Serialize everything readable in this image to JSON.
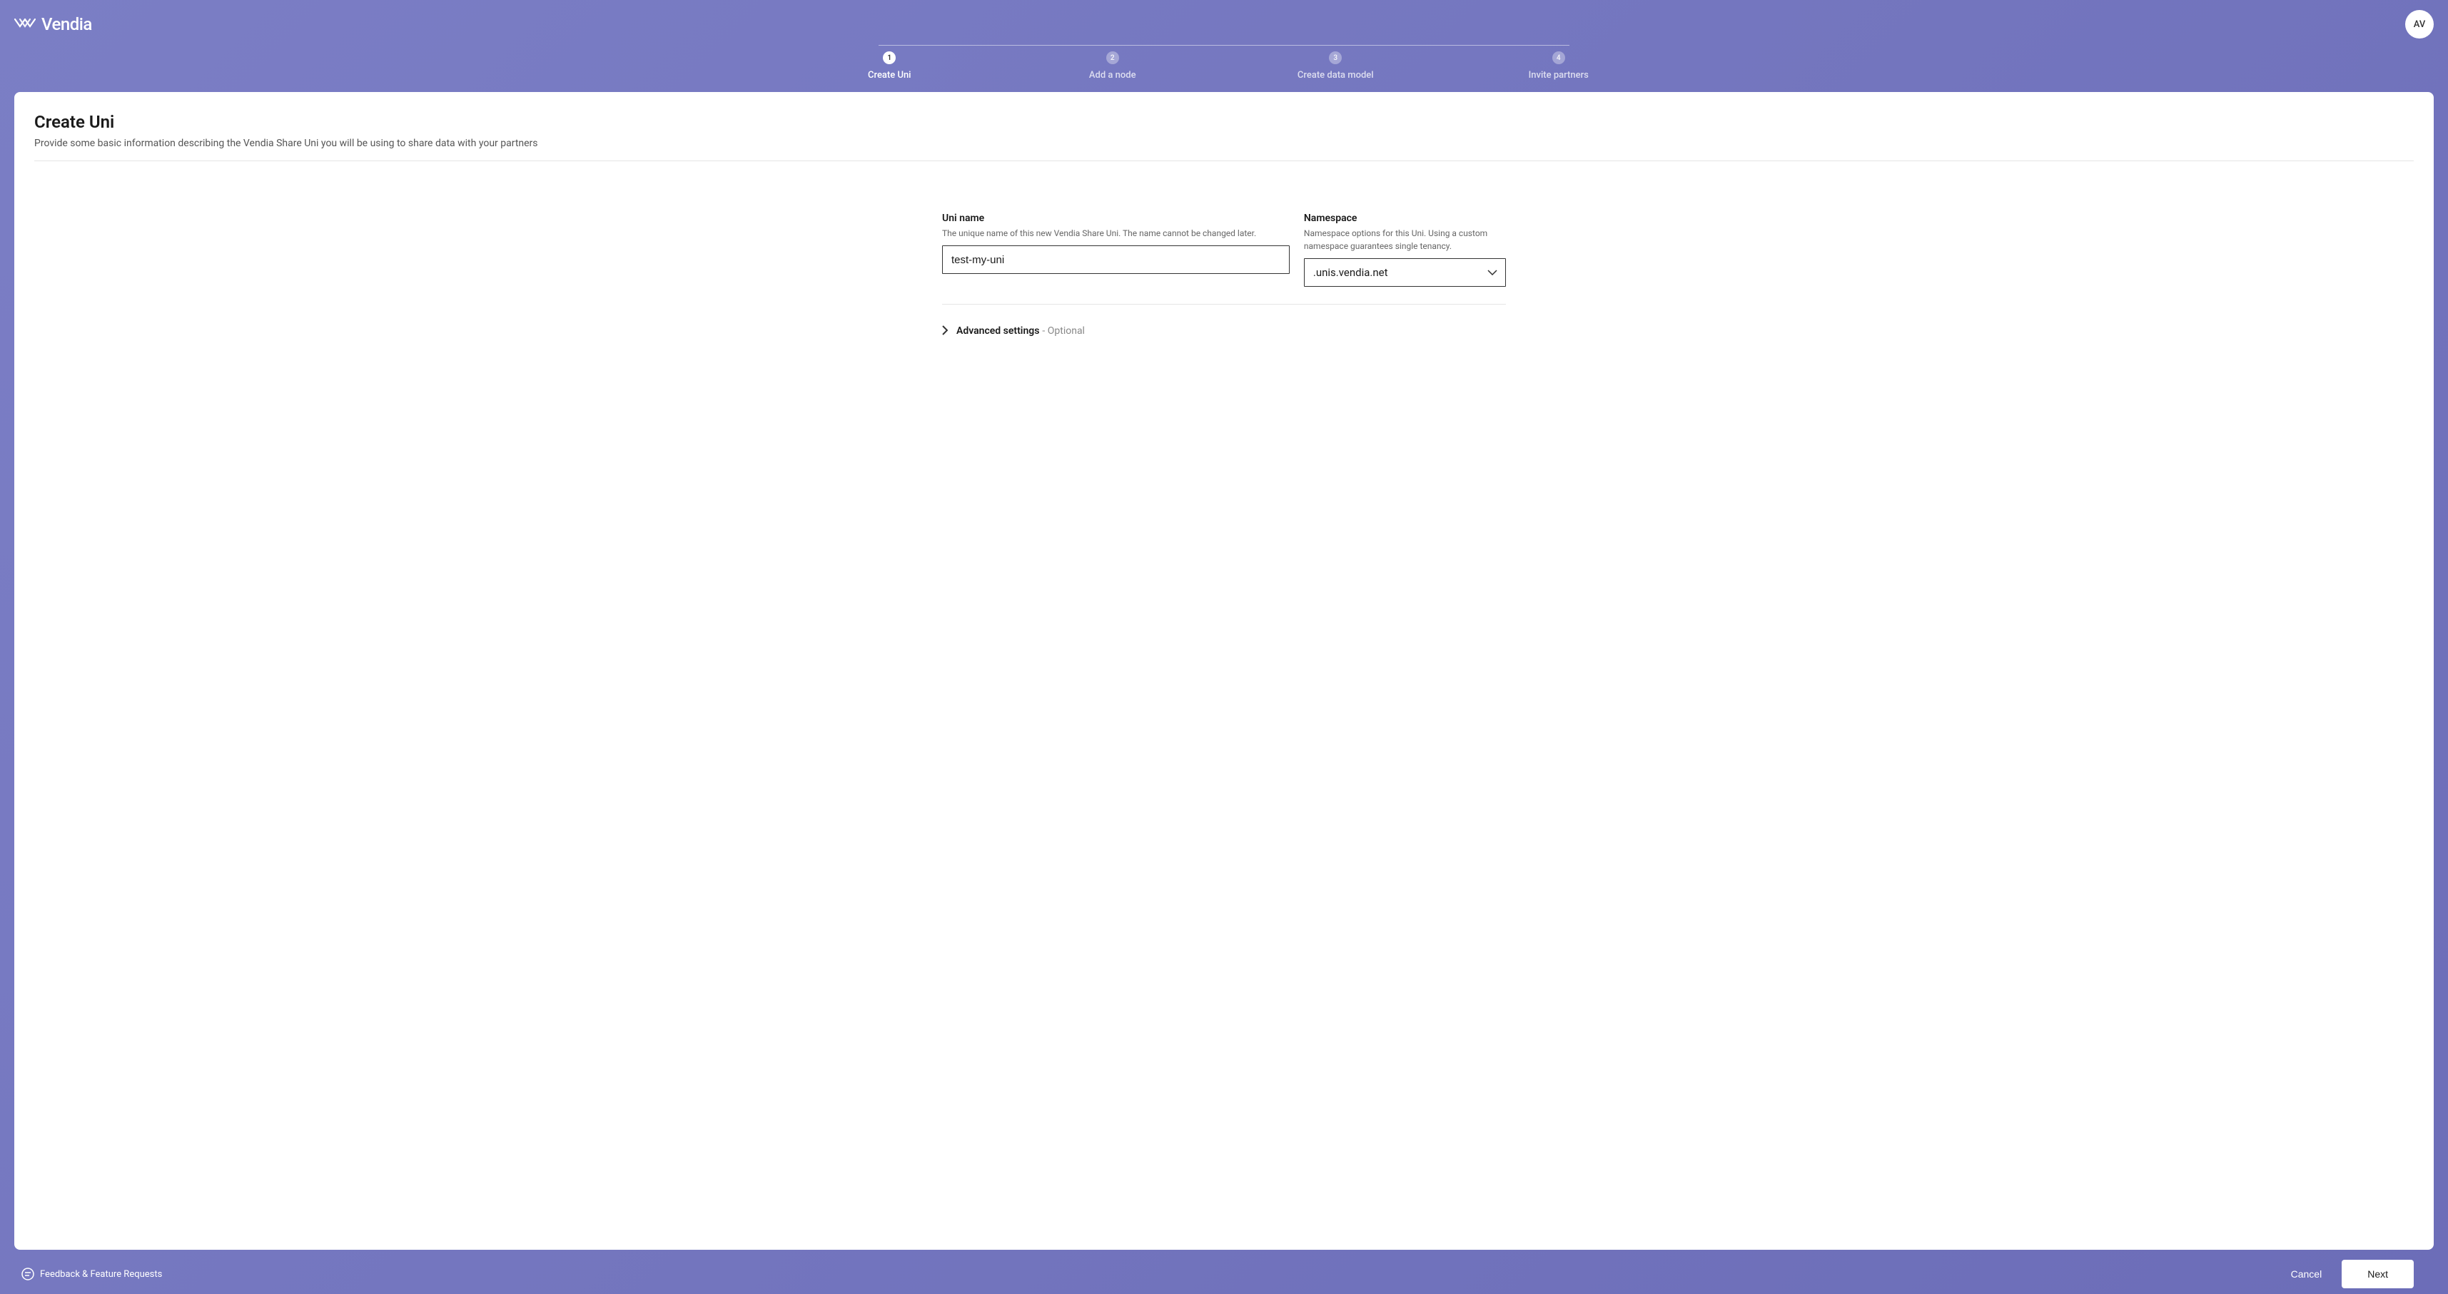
{
  "header": {
    "brand": "Vendia",
    "avatar_initials": "AV"
  },
  "stepper": {
    "steps": [
      {
        "number": "1",
        "label": "Create Uni",
        "active": true
      },
      {
        "number": "2",
        "label": "Add a node",
        "active": false
      },
      {
        "number": "3",
        "label": "Create data model",
        "active": false
      },
      {
        "number": "4",
        "label": "Invite partners",
        "active": false
      }
    ]
  },
  "page": {
    "title": "Create Uni",
    "subtitle": "Provide some basic information describing the Vendia Share Uni you will be using to share data with your partners"
  },
  "form": {
    "uni_name": {
      "label": "Uni name",
      "help": "The unique name of this new Vendia Share Uni. The name cannot be changed later.",
      "value": "test-my-uni"
    },
    "namespace": {
      "label": "Namespace",
      "help": "Namespace options for this Uni. Using a custom namespace guarantees single tenancy.",
      "value": ".unis.vendia.net"
    },
    "advanced": {
      "label": "Advanced settings",
      "optional": "- Optional"
    }
  },
  "footer": {
    "feedback_label": "Feedback & Feature Requests",
    "cancel_label": "Cancel",
    "next_label": "Next"
  }
}
